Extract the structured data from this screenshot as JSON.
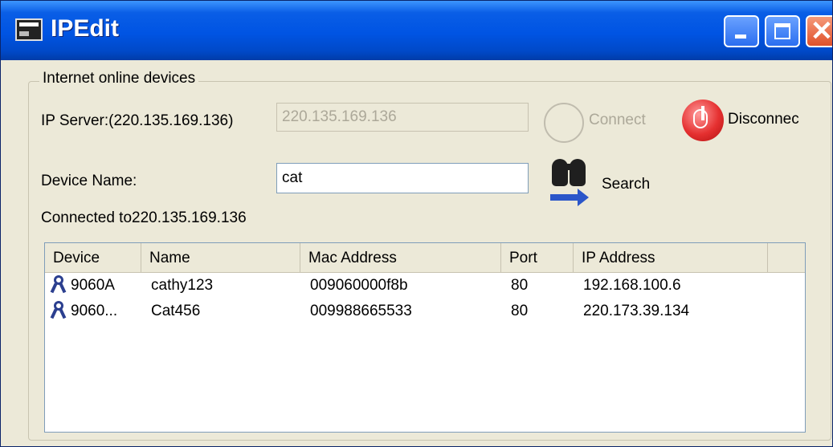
{
  "window": {
    "title": "IPEdit"
  },
  "titlebar": {
    "close_glyph": "✕"
  },
  "group": {
    "legend": "Internet online devices"
  },
  "server": {
    "label": "IP Server:(220.135.169.136)",
    "value": "220.135.169.136",
    "connect_label": "Connect",
    "disconnect_label": "Disconnec"
  },
  "device_name": {
    "label": "Device Name:",
    "value": "cat",
    "search_label": "Search"
  },
  "status": {
    "text": "Connected to220.135.169.136"
  },
  "list": {
    "columns": [
      "Device",
      "Name",
      "Mac Address",
      "Port",
      "IP Address"
    ],
    "rows": [
      {
        "device": "9060A",
        "name": "cathy123",
        "mac": "009060000f8b",
        "port": "80",
        "ip": "192.168.100.6"
      },
      {
        "device": "9060...",
        "name": "Cat456",
        "mac": "009988665533",
        "port": "80",
        "ip": "220.173.39.134"
      }
    ]
  },
  "colors": {
    "titlebar": "#0054e3",
    "window_bg": "#ece9d8",
    "disconnect": "#e53030",
    "search_arrow": "#2b56c9"
  }
}
